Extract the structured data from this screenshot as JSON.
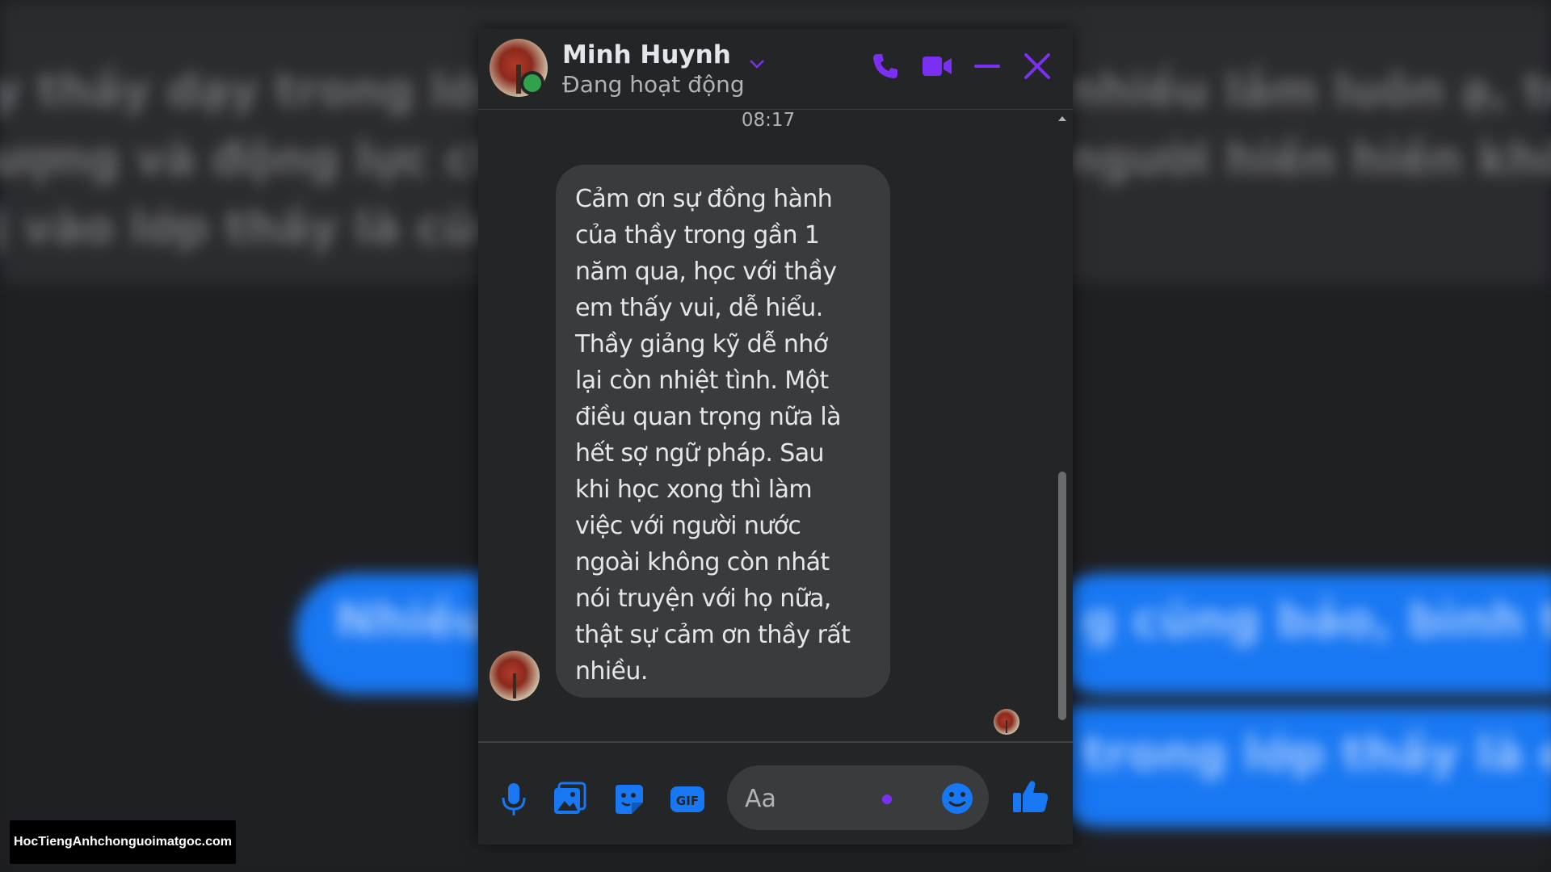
{
  "background": {
    "blurred_text_lines": [
      "y thầy dạy trong lớp l",
      "ượng và động lực cho",
      "ị vào lớp thầy là cũng",
      "nhiều lắm luôn ạ, truyề",
      "người hiền hiền khôn"
    ],
    "blurred_bubbles": [
      "Nhiều",
      "g cũng bảo, bình thườ",
      "trong lớp thầy là e b"
    ]
  },
  "chat": {
    "contact_name": "Minh Huynh",
    "contact_status": "Đang hoạt động",
    "timestamp": "08:17",
    "message": "Cảm ơn sự đồng hành\ncủa thầy trong gần 1\nnăm qua, học với thầy\nem thấy vui, dễ hiểu.\nThầy giảng kỹ dễ nhớ\nlại còn nhiệt tình. Một\nđiều quan trọng nữa là\nhết sợ ngữ pháp. Sau\nkhi học xong thì làm\nviệc với người nước\nngoài không còn nhát\nnói truyện với họ nữa,\nthật sự cảm ơn thầy rất\nnhiều.",
    "composer": {
      "placeholder": "Aa",
      "value": ""
    },
    "icons": {
      "header": [
        "chevron-down-icon",
        "phone-icon",
        "video-icon",
        "minimize-icon",
        "close-icon"
      ],
      "composer": [
        "microphone-icon",
        "image-icon",
        "sticker-icon",
        "gif-icon",
        "emoji-icon",
        "like-icon"
      ]
    },
    "colors": {
      "accent": "#7b2ff2",
      "composer_accent": "#1877f2",
      "online": "#31a24c",
      "bubble": "#3a3b3c",
      "window_bg": "#242526"
    }
  },
  "watermark": "HocTiengAnhchonguoimatgoc.com"
}
